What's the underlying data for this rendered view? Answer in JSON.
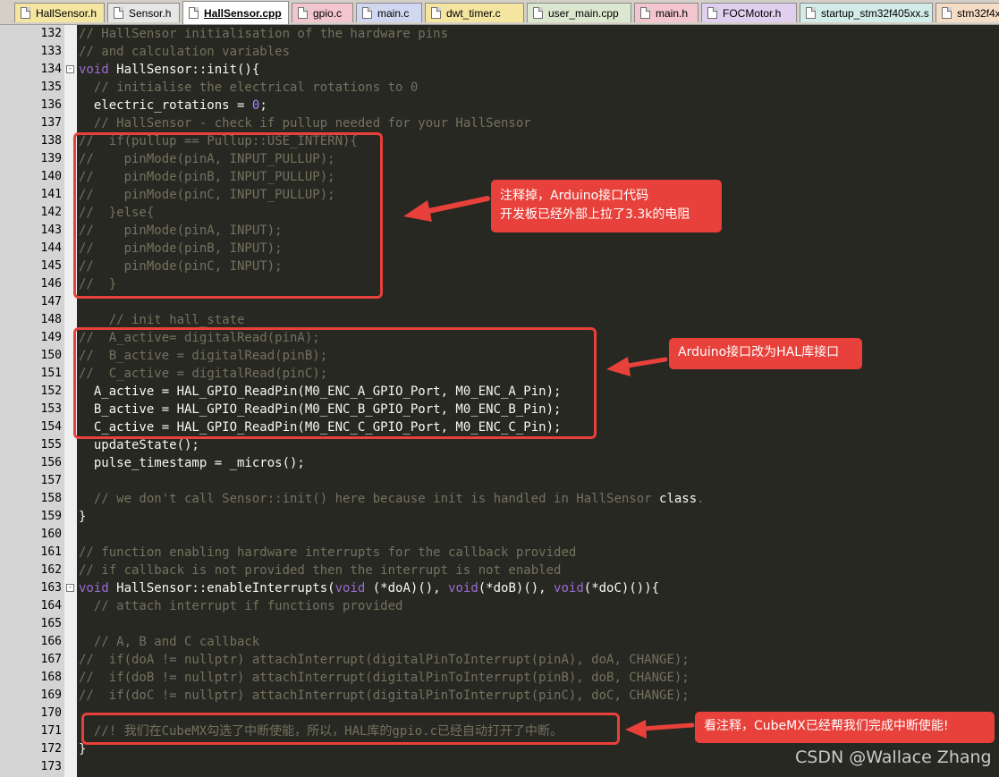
{
  "tabs": [
    {
      "label": "HallSensor.h",
      "color": "#f4e6a1",
      "active": false
    },
    {
      "label": "Sensor.h",
      "color": "#e6e6e6",
      "active": false
    },
    {
      "label": "HallSensor.cpp",
      "color": "#ffffff",
      "active": true
    },
    {
      "label": "gpio.c",
      "color": "#f2c5cf",
      "active": false
    },
    {
      "label": "main.c",
      "color": "#cfd8f0",
      "active": false
    },
    {
      "label": "dwt_timer.c",
      "color": "#f4e6a1",
      "active": false
    },
    {
      "label": "user_main.cpp",
      "color": "#dbe8cf",
      "active": false
    },
    {
      "label": "main.h",
      "color": "#f2c5cf",
      "active": false
    },
    {
      "label": "FOCMotor.h",
      "color": "#e1cff0",
      "active": false
    },
    {
      "label": "startup_stm32f405xx.s",
      "color": "#d4ece8",
      "active": false
    },
    {
      "label": "stm32f4x",
      "color": "#f5dcc4",
      "active": false
    }
  ],
  "code_lines": [
    {
      "num": "132",
      "tokens": [
        {
          "t": "// HallSensor initialisation of the hardware pins",
          "c": "c"
        }
      ]
    },
    {
      "num": "133",
      "tokens": [
        {
          "t": "// and calculation variables",
          "c": "c"
        }
      ]
    },
    {
      "num": "134",
      "fold": "-",
      "tokens": [
        {
          "t": "void",
          "c": "k"
        },
        {
          "t": " HallSensor::init(){",
          "c": ""
        }
      ]
    },
    {
      "num": "135",
      "tokens": [
        {
          "t": "  // initialise the electrical rotations to 0",
          "c": "c"
        }
      ]
    },
    {
      "num": "136",
      "tokens": [
        {
          "t": "  electric_rotations = ",
          "c": ""
        },
        {
          "t": "0",
          "c": "n"
        },
        {
          "t": ";",
          "c": ""
        }
      ]
    },
    {
      "num": "137",
      "tokens": [
        {
          "t": "  // HallSensor - check if pullup needed for your HallSensor",
          "c": "c"
        }
      ]
    },
    {
      "num": "138",
      "tokens": [
        {
          "t": "//  if(pullup == Pullup::USE_INTERN){",
          "c": "c"
        }
      ]
    },
    {
      "num": "139",
      "tokens": [
        {
          "t": "//    pinMode(pinA, INPUT_PULLUP);",
          "c": "c"
        }
      ]
    },
    {
      "num": "140",
      "tokens": [
        {
          "t": "//    pinMode(pinB, INPUT_PULLUP);",
          "c": "c"
        }
      ]
    },
    {
      "num": "141",
      "tokens": [
        {
          "t": "//    pinMode(pinC, INPUT_PULLUP);",
          "c": "c"
        }
      ]
    },
    {
      "num": "142",
      "tokens": [
        {
          "t": "//  }else{",
          "c": "c"
        }
      ]
    },
    {
      "num": "143",
      "tokens": [
        {
          "t": "//    pinMode(pinA, INPUT);",
          "c": "c"
        }
      ]
    },
    {
      "num": "144",
      "tokens": [
        {
          "t": "//    pinMode(pinB, INPUT);",
          "c": "c"
        }
      ]
    },
    {
      "num": "145",
      "tokens": [
        {
          "t": "//    pinMode(pinC, INPUT);",
          "c": "c"
        }
      ]
    },
    {
      "num": "146",
      "tokens": [
        {
          "t": "//  }",
          "c": "c"
        }
      ]
    },
    {
      "num": "147",
      "tokens": []
    },
    {
      "num": "148",
      "tokens": [
        {
          "t": "    // init hall_state",
          "c": "c"
        }
      ]
    },
    {
      "num": "149",
      "tokens": [
        {
          "t": "//  A_active= digitalRead(pinA);",
          "c": "c"
        }
      ]
    },
    {
      "num": "150",
      "tokens": [
        {
          "t": "//  B_active = digitalRead(pinB);",
          "c": "c"
        }
      ]
    },
    {
      "num": "151",
      "tokens": [
        {
          "t": "//  C_active = digitalRead(pinC);",
          "c": "c"
        }
      ]
    },
    {
      "num": "152",
      "tokens": [
        {
          "t": "  A_active = HAL_GPIO_ReadPin(M0_ENC_A_GPIO_Port, M0_ENC_A_Pin);",
          "c": ""
        }
      ]
    },
    {
      "num": "153",
      "tokens": [
        {
          "t": "  B_active = HAL_GPIO_ReadPin(M0_ENC_B_GPIO_Port, M0_ENC_B_Pin);",
          "c": ""
        }
      ]
    },
    {
      "num": "154",
      "tokens": [
        {
          "t": "  C_active = HAL_GPIO_ReadPin(M0_ENC_C_GPIO_Port, M0_ENC_C_Pin);",
          "c": ""
        }
      ]
    },
    {
      "num": "155",
      "tokens": [
        {
          "t": "  updateState();",
          "c": ""
        }
      ]
    },
    {
      "num": "156",
      "tokens": [
        {
          "t": "  pulse_timestamp = _micros();",
          "c": ""
        }
      ]
    },
    {
      "num": "157",
      "tokens": []
    },
    {
      "num": "158",
      "tokens": [
        {
          "t": "  // we don't call Sensor::init() here because init is handled in HallSensor ",
          "c": "c"
        },
        {
          "t": "class",
          "c": ""
        },
        {
          "t": ".",
          "c": "c"
        }
      ]
    },
    {
      "num": "159",
      "tokens": [
        {
          "t": "}",
          "c": ""
        }
      ]
    },
    {
      "num": "160",
      "tokens": []
    },
    {
      "num": "161",
      "tokens": [
        {
          "t": "// function enabling hardware interrupts for the callback provided",
          "c": "c"
        }
      ]
    },
    {
      "num": "162",
      "tokens": [
        {
          "t": "// if callback is not provided then the interrupt is not enabled",
          "c": "c"
        }
      ]
    },
    {
      "num": "163",
      "fold": "-",
      "tokens": [
        {
          "t": "void",
          "c": "k"
        },
        {
          "t": " HallSensor::enableInterrupts(",
          "c": ""
        },
        {
          "t": "void",
          "c": "k"
        },
        {
          "t": " (*doA)(), ",
          "c": ""
        },
        {
          "t": "void",
          "c": "k"
        },
        {
          "t": "(*doB)(), ",
          "c": ""
        },
        {
          "t": "void",
          "c": "k"
        },
        {
          "t": "(*doC)()){",
          "c": ""
        }
      ]
    },
    {
      "num": "164",
      "tokens": [
        {
          "t": "  // attach interrupt if functions provided",
          "c": "c"
        }
      ]
    },
    {
      "num": "165",
      "tokens": []
    },
    {
      "num": "166",
      "tokens": [
        {
          "t": "  // A, B and C callback",
          "c": "c"
        }
      ]
    },
    {
      "num": "167",
      "tokens": [
        {
          "t": "//  if(doA != nullptr) attachInterrupt(digitalPinToInterrupt(pinA), doA, CHANGE);",
          "c": "c"
        }
      ]
    },
    {
      "num": "168",
      "tokens": [
        {
          "t": "//  if(doB != nullptr) attachInterrupt(digitalPinToInterrupt(pinB), doB, CHANGE);",
          "c": "c"
        }
      ]
    },
    {
      "num": "169",
      "tokens": [
        {
          "t": "//  if(doC != nullptr) attachInterrupt(digitalPinToInterrupt(pinC), doC, CHANGE);",
          "c": "c"
        }
      ]
    },
    {
      "num": "170",
      "tokens": []
    },
    {
      "num": "171",
      "tokens": [
        {
          "t": "  //! 我们在CubeMX勾选了中断使能，所以，HAL库的gpio.c已经自动打开了中断。",
          "c": "c"
        }
      ]
    },
    {
      "num": "172",
      "tokens": [
        {
          "t": "}",
          "c": ""
        }
      ]
    },
    {
      "num": "173",
      "tokens": []
    }
  ],
  "annotations": {
    "callout_1": "注释掉，Arduino接口代码\n开发板已经外部上拉了3.3k的电阻",
    "callout_2": "Arduino接口改为HAL库接口",
    "callout_3": "看注释，CubeMX已经帮我们完成中断使能!"
  },
  "watermark": "CSDN @Wallace Zhang",
  "colors": {
    "editor_bg": "#272822",
    "comment": "#75715e",
    "keyword": "#9b6bd1",
    "number": "#ae81ff",
    "annotation_red": "#e8403a"
  }
}
